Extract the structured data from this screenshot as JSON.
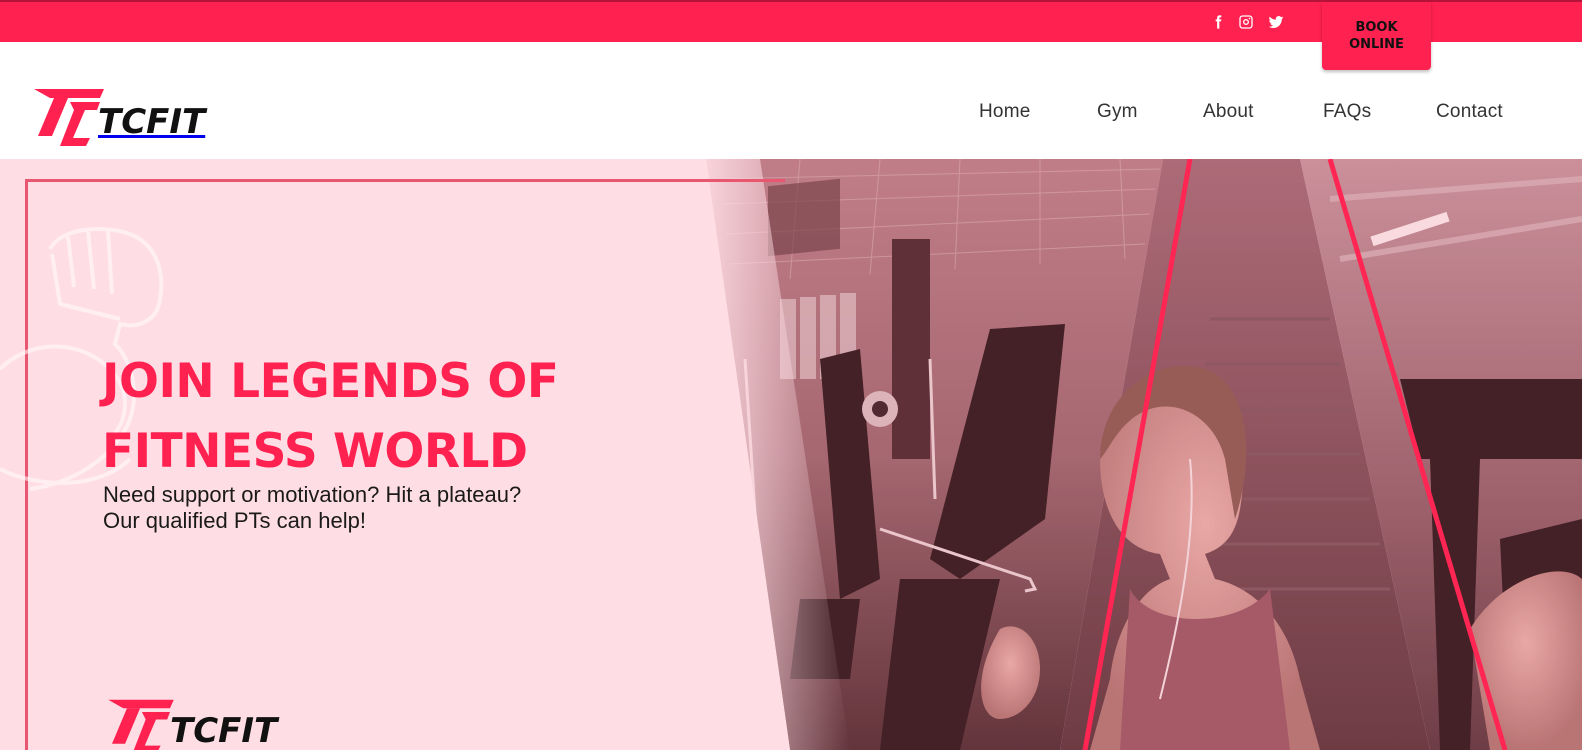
{
  "colors": {
    "brand": "#ff2150",
    "hero_bg": "#ffdde4",
    "text_dark": "#1a1a1a"
  },
  "social": [
    {
      "name": "facebook",
      "icon": "facebook-icon"
    },
    {
      "name": "instagram",
      "icon": "instagram-icon"
    },
    {
      "name": "twitter",
      "icon": "twitter-icon"
    }
  ],
  "book_button": {
    "line1": "BOOK",
    "line2": "ONLINE"
  },
  "logo": {
    "text": "TCFIT"
  },
  "nav": [
    {
      "label": "Home"
    },
    {
      "label": "Gym"
    },
    {
      "label": "About"
    },
    {
      "label": "FAQs"
    },
    {
      "label": "Contact"
    }
  ],
  "hero": {
    "title_line1": "JOIN LEGENDS OF",
    "title_line2": "FITNESS WORLD",
    "subtitle_line1": "Need support or motivation? Hit a plateau?",
    "subtitle_line2": "Our qualified PTs can help!"
  }
}
